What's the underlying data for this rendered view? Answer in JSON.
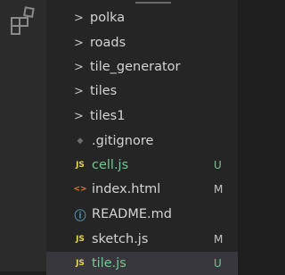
{
  "activity_bar": {
    "icon": "extensions-icon"
  },
  "explorer": {
    "folders": [
      {
        "label": "polka",
        "icon": "chevron-right-icon"
      },
      {
        "label": "roads",
        "icon": "chevron-right-icon"
      },
      {
        "label": "tile_generator",
        "icon": "chevron-right-icon"
      },
      {
        "label": "tiles",
        "icon": "chevron-right-icon"
      },
      {
        "label": "tiles1",
        "icon": "chevron-right-icon"
      }
    ],
    "files": [
      {
        "label": ".gitignore",
        "icon": "gitignore-file-icon",
        "glyph": "◆",
        "badge": ""
      },
      {
        "label": "cell.js",
        "icon": "js-file-icon",
        "glyph": "JS",
        "badge": "U"
      },
      {
        "label": "index.html",
        "icon": "html-file-icon",
        "glyph": "<>",
        "badge": "M"
      },
      {
        "label": "README.md",
        "icon": "info-file-icon",
        "glyph": "ⓘ",
        "badge": ""
      },
      {
        "label": "sketch.js",
        "icon": "js-file-icon",
        "glyph": "JS",
        "badge": "M"
      },
      {
        "label": "tile.js",
        "icon": "js-file-icon",
        "glyph": "JS",
        "badge": "U"
      }
    ],
    "colors": {
      "untracked": "#73c991",
      "modified": "#e2c08d",
      "js": "#e8d44d",
      "html": "#e37933",
      "info": "#519aba"
    }
  }
}
